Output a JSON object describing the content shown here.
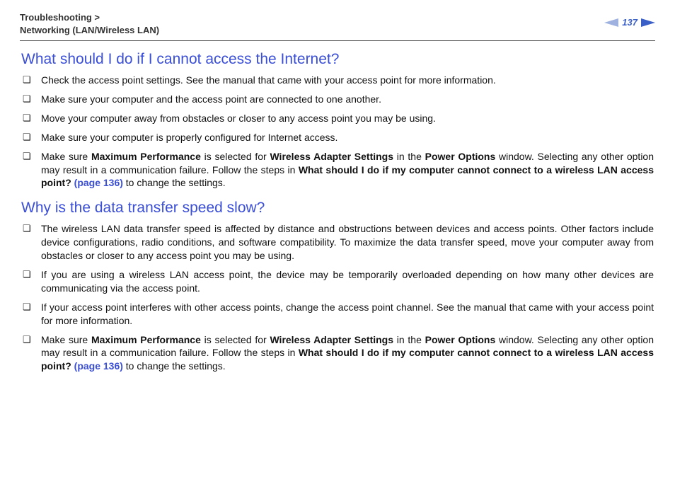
{
  "header": {
    "breadcrumb_l1": "Troubleshooting >",
    "breadcrumb_l2": "Networking (LAN/Wireless LAN)",
    "page_number": "137"
  },
  "sections": [
    {
      "heading": "What should I do if I cannot access the Internet?",
      "items": [
        {
          "html": "Check the access point settings. See the manual that came with your access point for more information."
        },
        {
          "html": "Make sure your computer and the access point are connected to one another."
        },
        {
          "html": "Move your computer away from obstacles or closer to any access point you may be using."
        },
        {
          "html": "Make sure your computer is properly configured for Internet access."
        },
        {
          "html": "Make sure <span class='bold'>Maximum Performance</span> is selected for <span class='bold'>Wireless Adapter Settings</span> in the <span class='bold'>Power Options</span> window. Selecting any other option may result in a communication failure. Follow the steps in <span class='bold'>What should I do if my computer cannot connect to a wireless LAN access point? <span class='link'>(page 136)</span></span> to change the settings."
        }
      ]
    },
    {
      "heading": "Why is the data transfer speed slow?",
      "items": [
        {
          "html": "The wireless LAN data transfer speed is affected by distance and obstructions between devices and access points. Other factors include device configurations, radio conditions, and software compatibility. To maximize the data transfer speed, move your computer away from obstacles or closer to any access point you may be using."
        },
        {
          "html": "If you are using a wireless LAN access point, the device may be temporarily overloaded depending on how many other devices are communicating via the access point."
        },
        {
          "html": "If your access point interferes with other access points, change the access point channel. See the manual that came with your access point for more information."
        },
        {
          "html": "Make sure <span class='bold'>Maximum Performance</span> is selected for <span class='bold'>Wireless Adapter Settings</span> in the <span class='bold'>Power Options</span> window. Selecting any other option may result in a communication failure. Follow the steps in <span class='bold'>What should I do if my computer cannot connect to a wireless LAN access point? <span class='link'>(page 136)</span></span> to change the settings."
        }
      ]
    }
  ]
}
